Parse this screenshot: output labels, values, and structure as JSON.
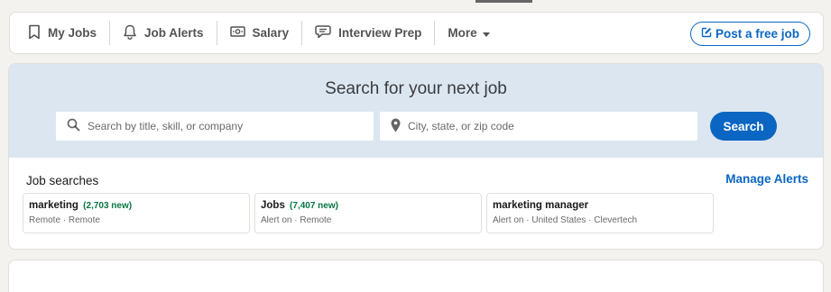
{
  "nav": {
    "items": [
      {
        "label": "My Jobs",
        "icon": "bookmark-icon"
      },
      {
        "label": "Job Alerts",
        "icon": "bell-icon"
      },
      {
        "label": "Salary",
        "icon": "money-icon"
      },
      {
        "label": "Interview Prep",
        "icon": "chat-bubble-icon"
      }
    ],
    "more_label": "More",
    "post_job_label": "Post a free job"
  },
  "search": {
    "heading": "Search for your next job",
    "title_placeholder": "Search by title, skill, or company",
    "location_placeholder": "City, state, or zip code",
    "button_label": "Search"
  },
  "job_searches": {
    "label": "Job searches",
    "manage_label": "Manage Alerts",
    "items": [
      {
        "title": "marketing",
        "new_count": "(2,703 new)",
        "meta": "Remote · Remote"
      },
      {
        "title": "Jobs",
        "new_count": "(7,407 new)",
        "meta": "Alert on · Remote"
      },
      {
        "title": "marketing manager",
        "new_count": "",
        "meta": "Alert on · United States · Clevertech"
      }
    ]
  },
  "colors": {
    "brand_blue": "#0a66c2",
    "hero_bg": "#dce6f1",
    "new_green": "#057642",
    "page_bg": "#f3f2ef"
  }
}
